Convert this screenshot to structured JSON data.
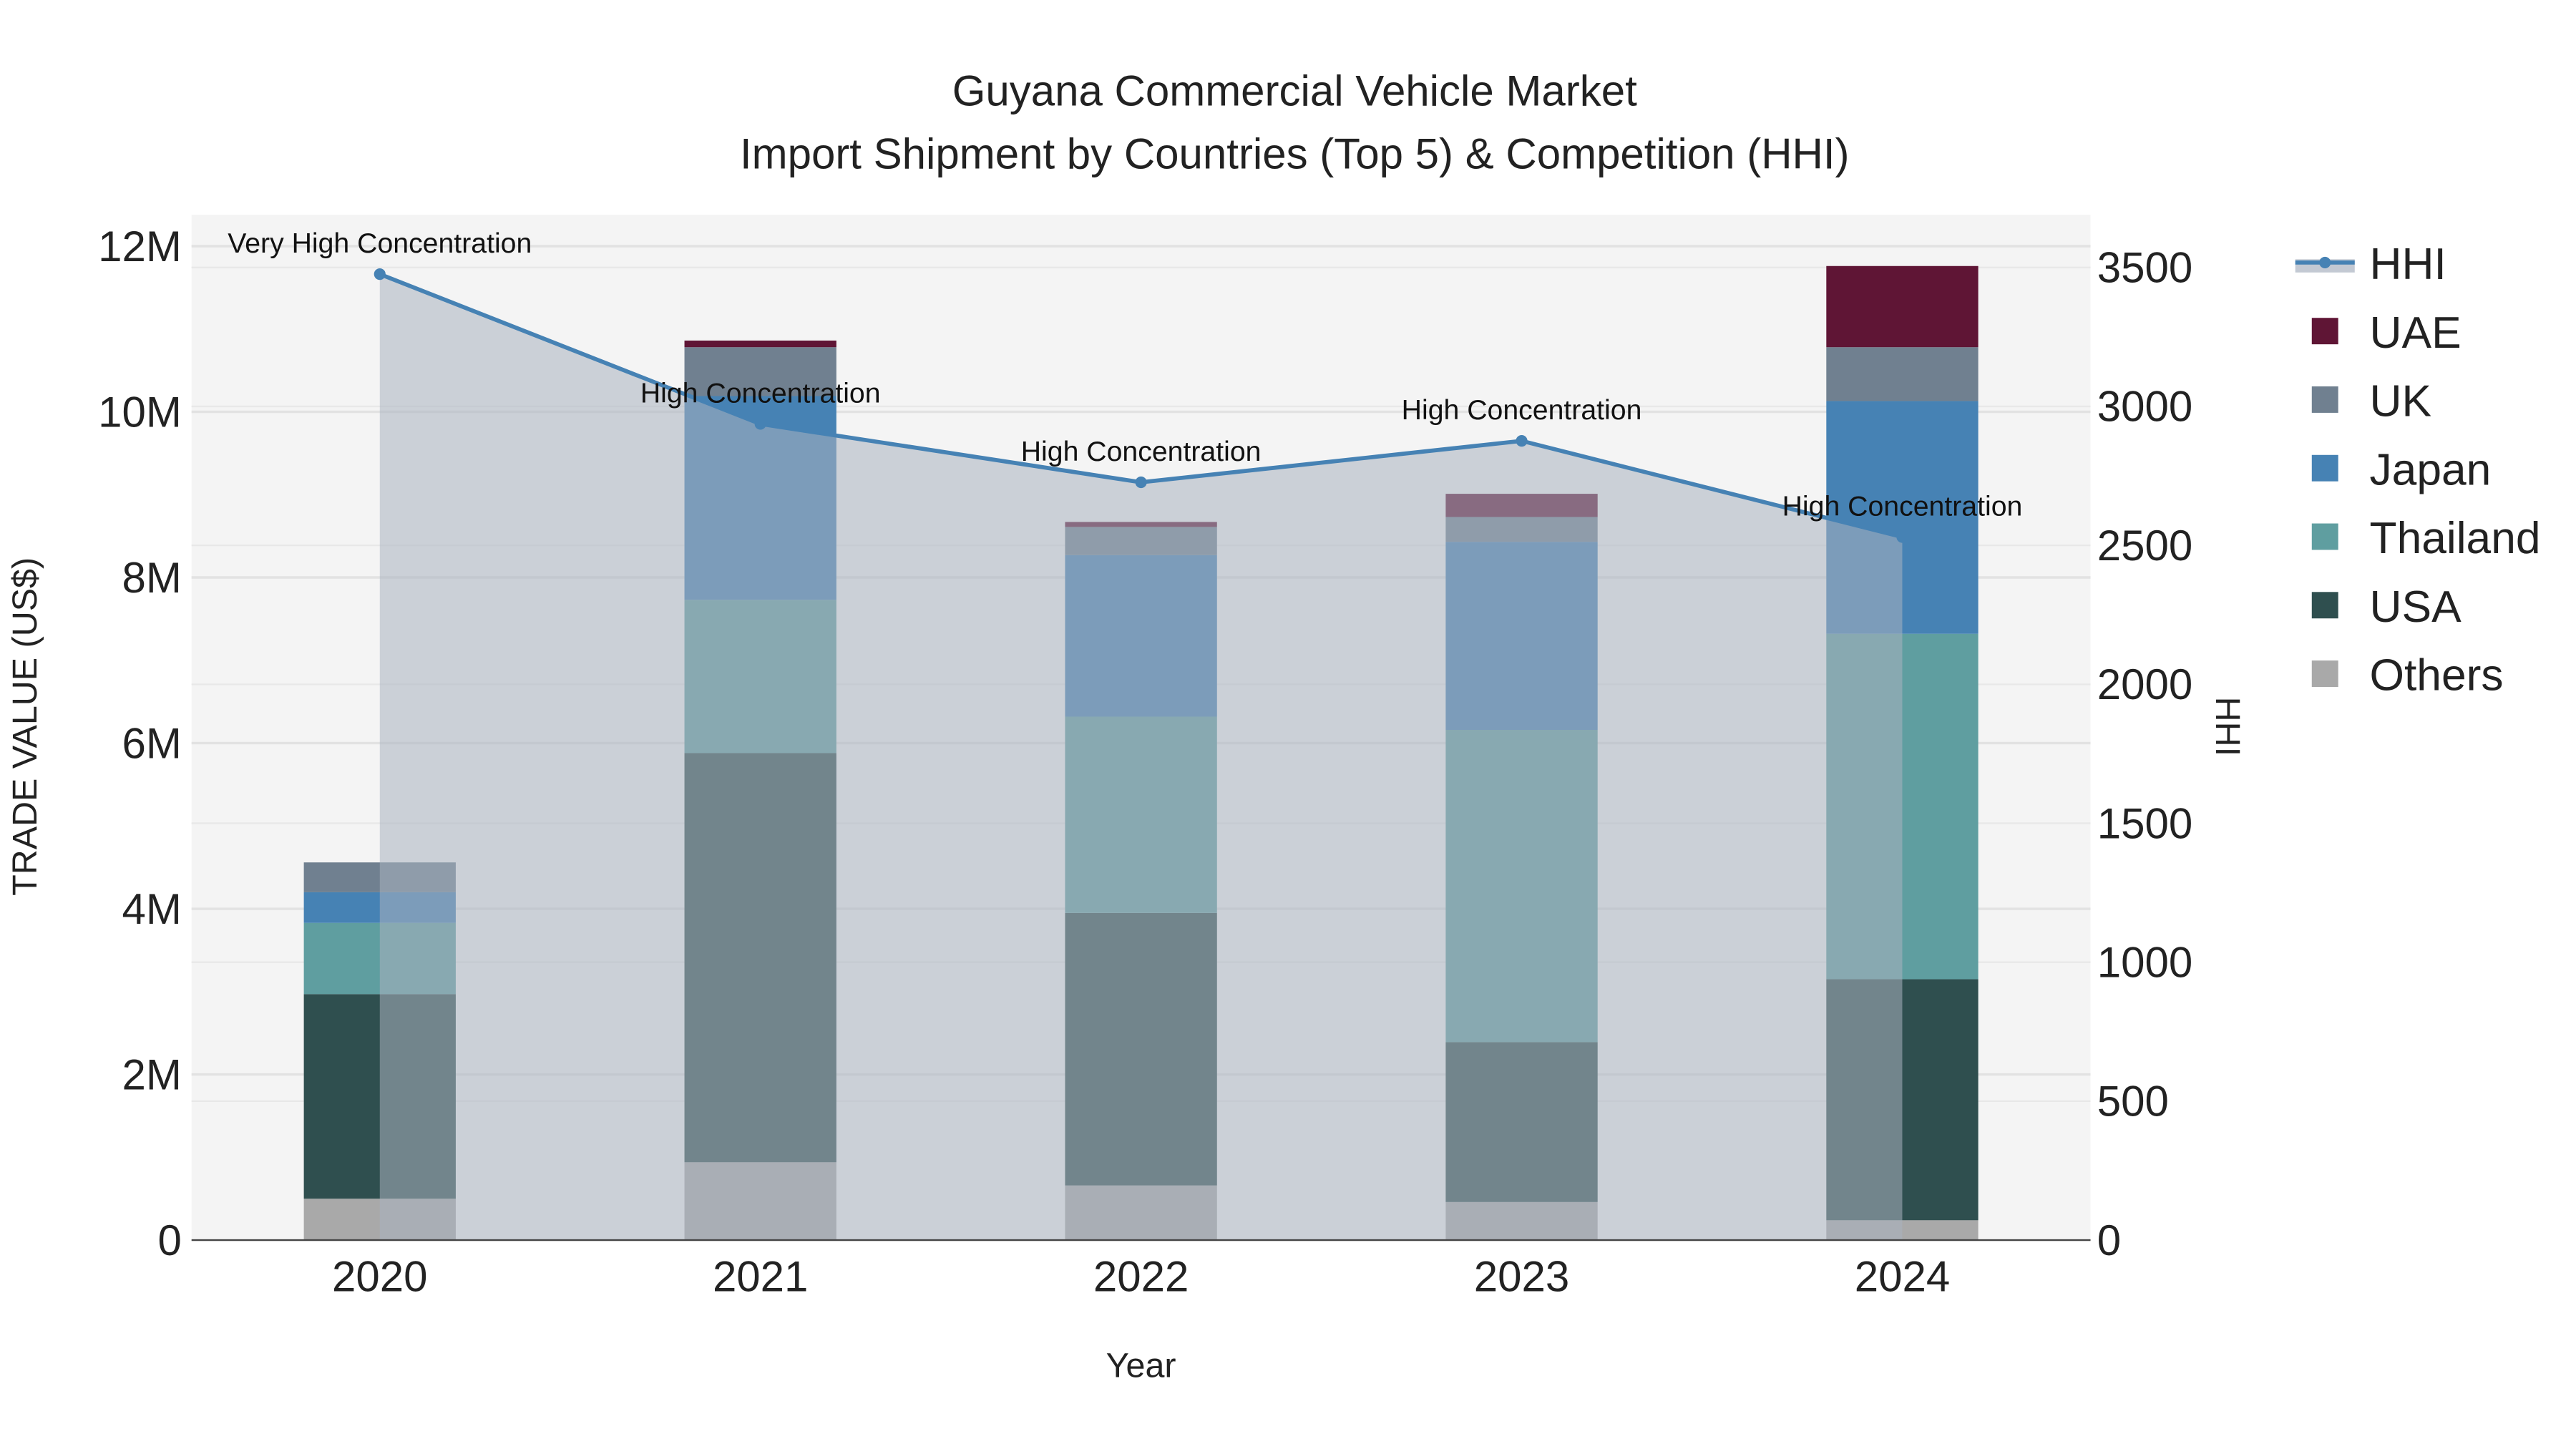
{
  "chart_data": {
    "type": "bar",
    "title": "Guyana Commercial Vehicle Market",
    "subtitle": "Import Shipment by Countries (Top 5) & Competition (HHI)",
    "xlabel": "Year",
    "ylabel": "TRADE VALUE (US$)",
    "y2label": "HHI",
    "categories": [
      "2020",
      "2021",
      "2022",
      "2023",
      "2024"
    ],
    "ylim": [
      0,
      12.38
    ],
    "y_unit": "M",
    "y_ticks": [
      0,
      2,
      4,
      6,
      8,
      10,
      12
    ],
    "y_tick_labels": [
      "0",
      "2M",
      "4M",
      "6M",
      "8M",
      "10M",
      "12M"
    ],
    "y2lim": [
      0,
      3690
    ],
    "y2_ticks": [
      0,
      500,
      1000,
      1500,
      2000,
      2500,
      3000,
      3500
    ],
    "y2_tick_labels": [
      "0",
      "500",
      "1000",
      "1500",
      "2000",
      "2500",
      "3000",
      "3500"
    ],
    "series": [
      {
        "name": "Others",
        "color": "#a9a9a9",
        "values": [
          0.5,
          0.94,
          0.66,
          0.46,
          0.24
        ]
      },
      {
        "name": "USA",
        "color": "#2f4f4f",
        "values": [
          2.47,
          4.94,
          3.29,
          1.93,
          2.91
        ]
      },
      {
        "name": "Thailand",
        "color": "#5f9ea0",
        "values": [
          0.86,
          1.85,
          2.37,
          3.77,
          4.17
        ]
      },
      {
        "name": "Japan",
        "color": "#4682b4",
        "values": [
          0.37,
          2.46,
          1.95,
          2.27,
          2.81
        ]
      },
      {
        "name": "UK",
        "color": "#708090",
        "values": [
          0.36,
          0.59,
          0.34,
          0.3,
          0.65
        ]
      },
      {
        "name": "UAE",
        "color": "#5f1535",
        "values": [
          0.0,
          0.08,
          0.06,
          0.28,
          0.98
        ]
      }
    ],
    "line": {
      "name": "HHI",
      "color": "#4682b4",
      "values": [
        3476,
        2937,
        2727,
        2876,
        2530
      ],
      "annotations": [
        "Very High Concentration",
        "High Concentration",
        "High Concentration",
        "High Concentration",
        "High Concentration"
      ]
    },
    "legend_order": [
      "HHI",
      "UAE",
      "UK",
      "Japan",
      "Thailand",
      "USA",
      "Others"
    ],
    "legend": "right",
    "grid": true
  }
}
